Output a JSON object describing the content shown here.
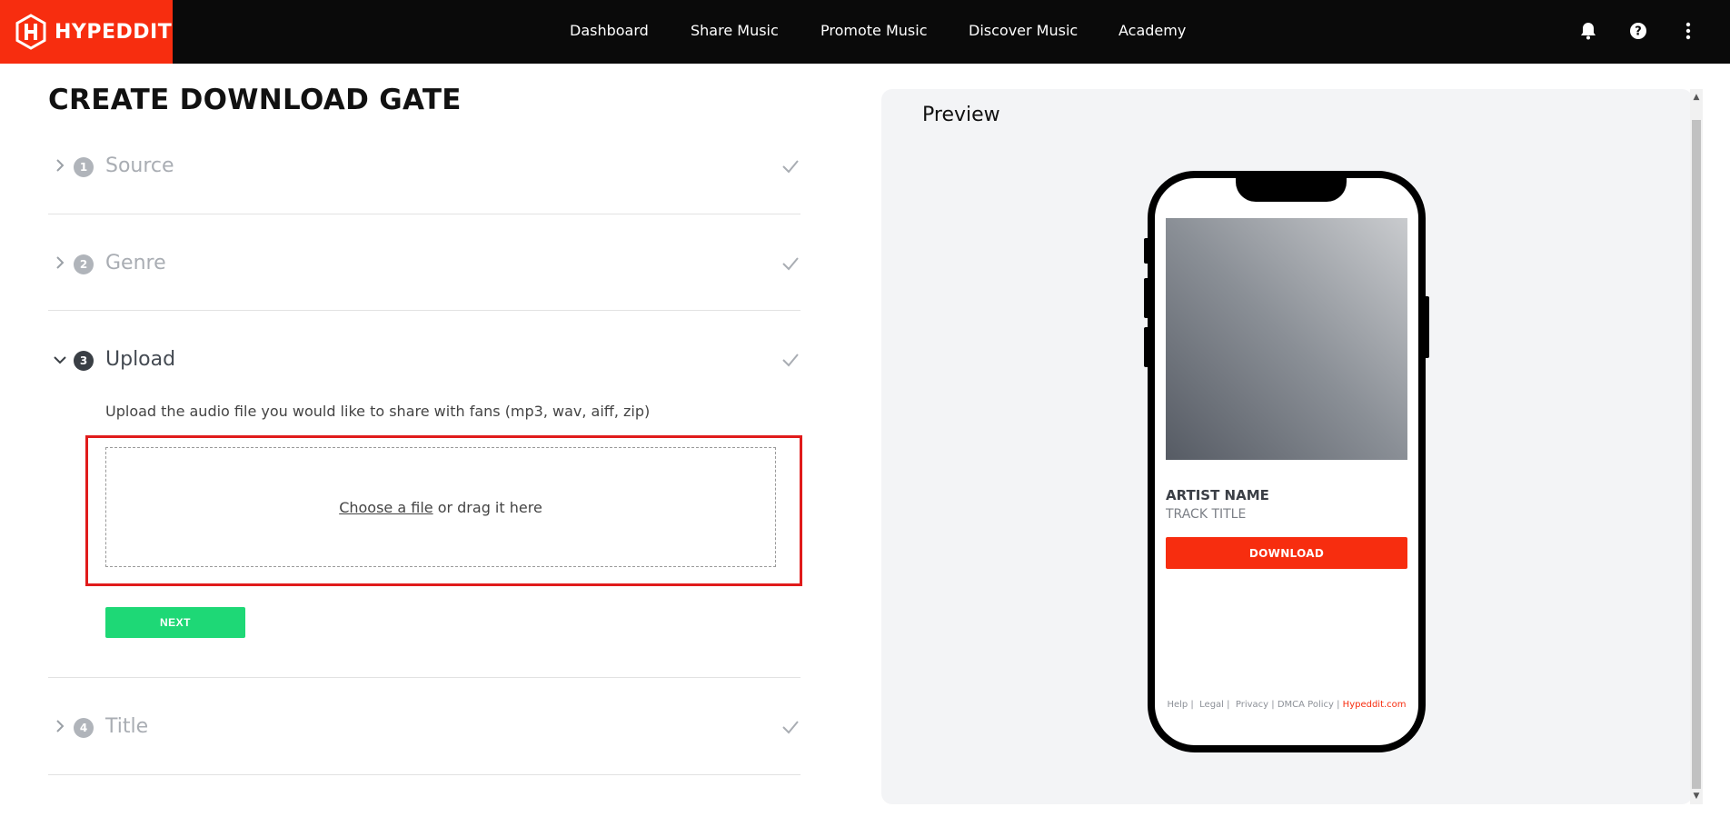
{
  "app": {
    "logo_text": "HYPEDDIT",
    "brand_color": "#f72d0f"
  },
  "nav": {
    "items": [
      "Dashboard",
      "Share Music",
      "Promote Music",
      "Discover Music",
      "Academy"
    ],
    "icons": [
      "bell-icon",
      "help-icon",
      "more-vertical-icon"
    ]
  },
  "page": {
    "title": "CREATE DOWNLOAD GATE"
  },
  "steps": [
    {
      "number": "1",
      "label": "Source",
      "state": "collapsed-complete"
    },
    {
      "number": "2",
      "label": "Genre",
      "state": "collapsed-complete"
    },
    {
      "number": "3",
      "label": "Upload",
      "state": "expanded"
    },
    {
      "number": "4",
      "label": "Title",
      "state": "collapsed-complete"
    }
  ],
  "upload": {
    "description": "Upload the audio file you would like to share with fans (mp3, wav, aiff, zip)",
    "choose_link": "Choose a file",
    "drag_text": " or drag it here",
    "next_label": "NEXT"
  },
  "preview": {
    "title": "Preview",
    "artist_name": "ARTIST NAME",
    "track_title": "TRACK TITLE",
    "download_label": "DOWNLOAD",
    "footer": {
      "help": "Help |",
      "legal": "Legal |",
      "privacy": "Privacy |",
      "dmca": "DMCA Policy |",
      "site": "Hypeddit.com"
    }
  },
  "colors": {
    "next_button": "#1ed876",
    "download_button": "#f72d0f",
    "highlight_border": "#e01b1b"
  }
}
